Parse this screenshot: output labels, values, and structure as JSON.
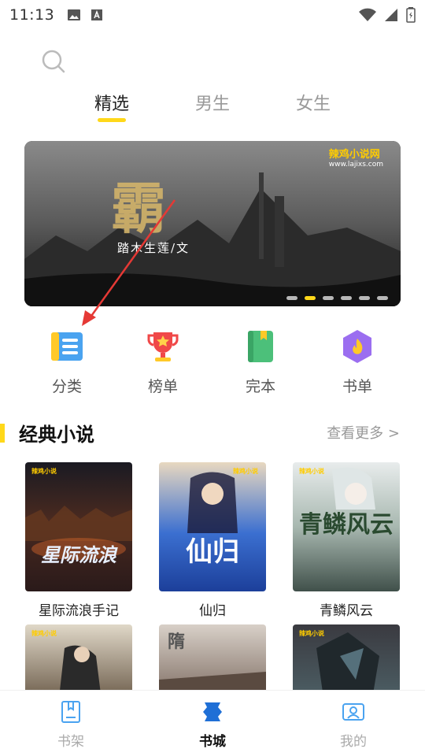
{
  "status_bar": {
    "time": "11:13",
    "left_icons": [
      "image-icon",
      "text-a-icon"
    ],
    "right_icons": [
      "wifi-icon",
      "signal-icon",
      "battery-icon"
    ]
  },
  "search": {
    "icon": "search-icon"
  },
  "top_tabs": [
    {
      "label": "精选",
      "active": true
    },
    {
      "label": "男生",
      "active": false
    },
    {
      "label": "女生",
      "active": false
    }
  ],
  "banner": {
    "brand": "辣鸡小说网",
    "brand_url": "www.lajixs.com",
    "subtitle": "踏木生莲/文",
    "dots": 6,
    "active_dot": 2
  },
  "categories": [
    {
      "label": "分类",
      "icon": "category-list-icon",
      "color": "#4aa3f0"
    },
    {
      "label": "榜单",
      "icon": "trophy-icon",
      "color": "#f04848"
    },
    {
      "label": "完本",
      "icon": "book-complete-icon",
      "color": "#4cc07a"
    },
    {
      "label": "书单",
      "icon": "booklist-flame-icon",
      "color": "#9b6ef0"
    }
  ],
  "section": {
    "title": "经典小说",
    "more": "查看更多 >"
  },
  "books": [
    {
      "title": "星际流浪手记",
      "cover_text": "星际流浪"
    },
    {
      "title": "仙归",
      "cover_text": "仙归"
    },
    {
      "title": "青鳞风云",
      "cover_text": "青鳞风云"
    },
    {
      "title": "",
      "cover_text": ""
    },
    {
      "title": "",
      "cover_text": "隋"
    },
    {
      "title": "",
      "cover_text": ""
    }
  ],
  "bottom_nav": [
    {
      "label": "书架",
      "icon": "bookshelf-icon",
      "active": false
    },
    {
      "label": "书城",
      "icon": "bookstore-icon",
      "active": true
    },
    {
      "label": "我的",
      "icon": "profile-icon",
      "active": false
    }
  ],
  "colors": {
    "accent": "#ffd81a",
    "annotation": "#e53935"
  }
}
